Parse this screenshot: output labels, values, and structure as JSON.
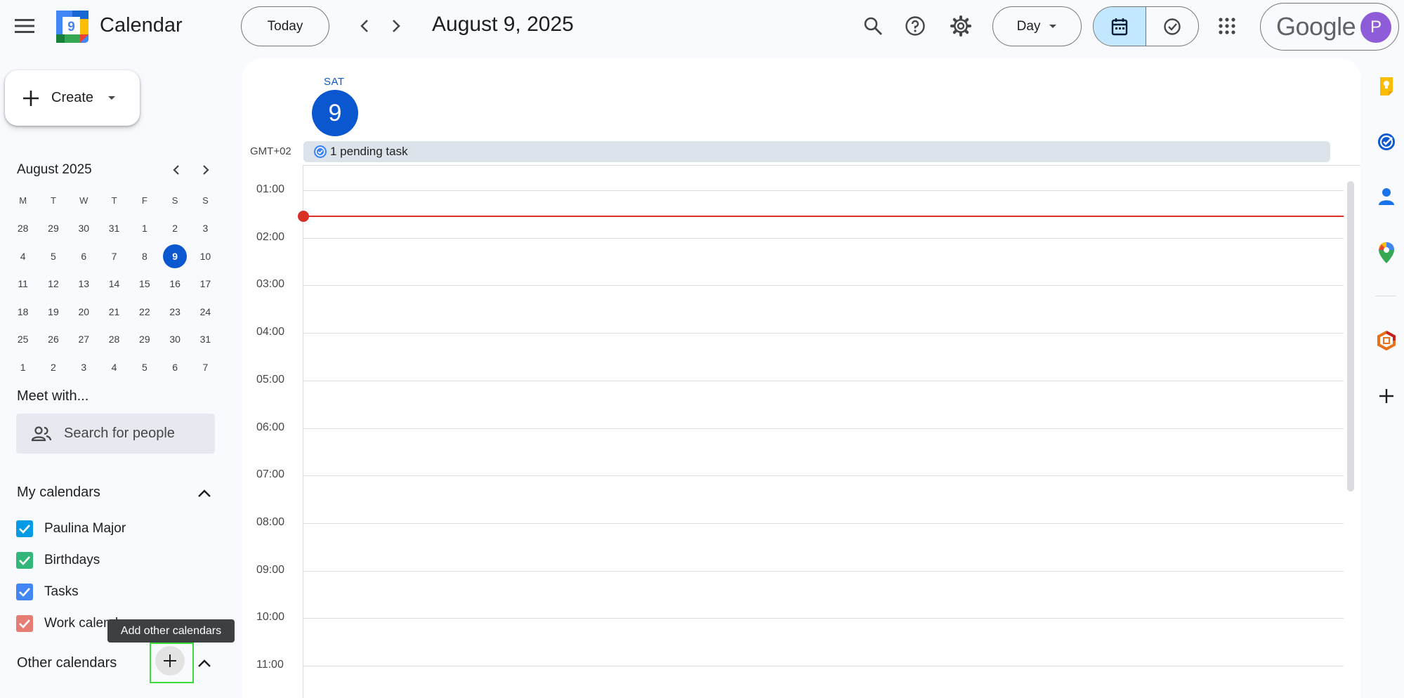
{
  "app": {
    "title": "Calendar",
    "logo_day": "9"
  },
  "header": {
    "today_label": "Today",
    "date_title": "August 9, 2025",
    "view_label": "Day",
    "account_wordmark": "Google",
    "avatar_initial": "P"
  },
  "sidebar": {
    "create_label": "Create",
    "mini_calendar": {
      "month_label": "August 2025",
      "weekday_headers": [
        "M",
        "T",
        "W",
        "T",
        "F",
        "S",
        "S"
      ],
      "weeks": [
        [
          "28",
          "29",
          "30",
          "31",
          "1",
          "2",
          "3"
        ],
        [
          "4",
          "5",
          "6",
          "7",
          "8",
          "9",
          "10"
        ],
        [
          "11",
          "12",
          "13",
          "14",
          "15",
          "16",
          "17"
        ],
        [
          "18",
          "19",
          "20",
          "21",
          "22",
          "23",
          "24"
        ],
        [
          "25",
          "26",
          "27",
          "28",
          "29",
          "30",
          "31"
        ],
        [
          "1",
          "2",
          "3",
          "4",
          "5",
          "6",
          "7"
        ]
      ],
      "selected_day": "9"
    },
    "meet_with": {
      "title": "Meet with...",
      "search_placeholder": "Search for people"
    },
    "my_calendars": {
      "title": "My calendars",
      "items": [
        {
          "label": "Paulina Major",
          "color": "#039be5"
        },
        {
          "label": "Birthdays",
          "color": "#33b679"
        },
        {
          "label": "Tasks",
          "color": "#4285f4"
        },
        {
          "label": "Work calendar",
          "color": "#e67c73"
        }
      ]
    },
    "other_calendars": {
      "title": "Other calendars",
      "add_tooltip": "Add other calendars"
    }
  },
  "day_view": {
    "weekday": "SAT",
    "day_number": "9",
    "timezone": "GMT+02",
    "pending_task": "1 pending task",
    "hours": [
      "01:00",
      "02:00",
      "03:00",
      "04:00",
      "05:00",
      "06:00",
      "07:00",
      "08:00",
      "09:00",
      "10:00",
      "11:00"
    ]
  },
  "colors": {
    "accent": "#0b57d0",
    "now_indicator": "#d93025",
    "active_toggle": "#c2e7ff",
    "avatar": "#8e5cd9"
  },
  "right_rail": {
    "icons": [
      "keep-icon",
      "tasks-icon",
      "contacts-icon",
      "maps-icon",
      "office-icon",
      "add-addon-icon"
    ]
  }
}
